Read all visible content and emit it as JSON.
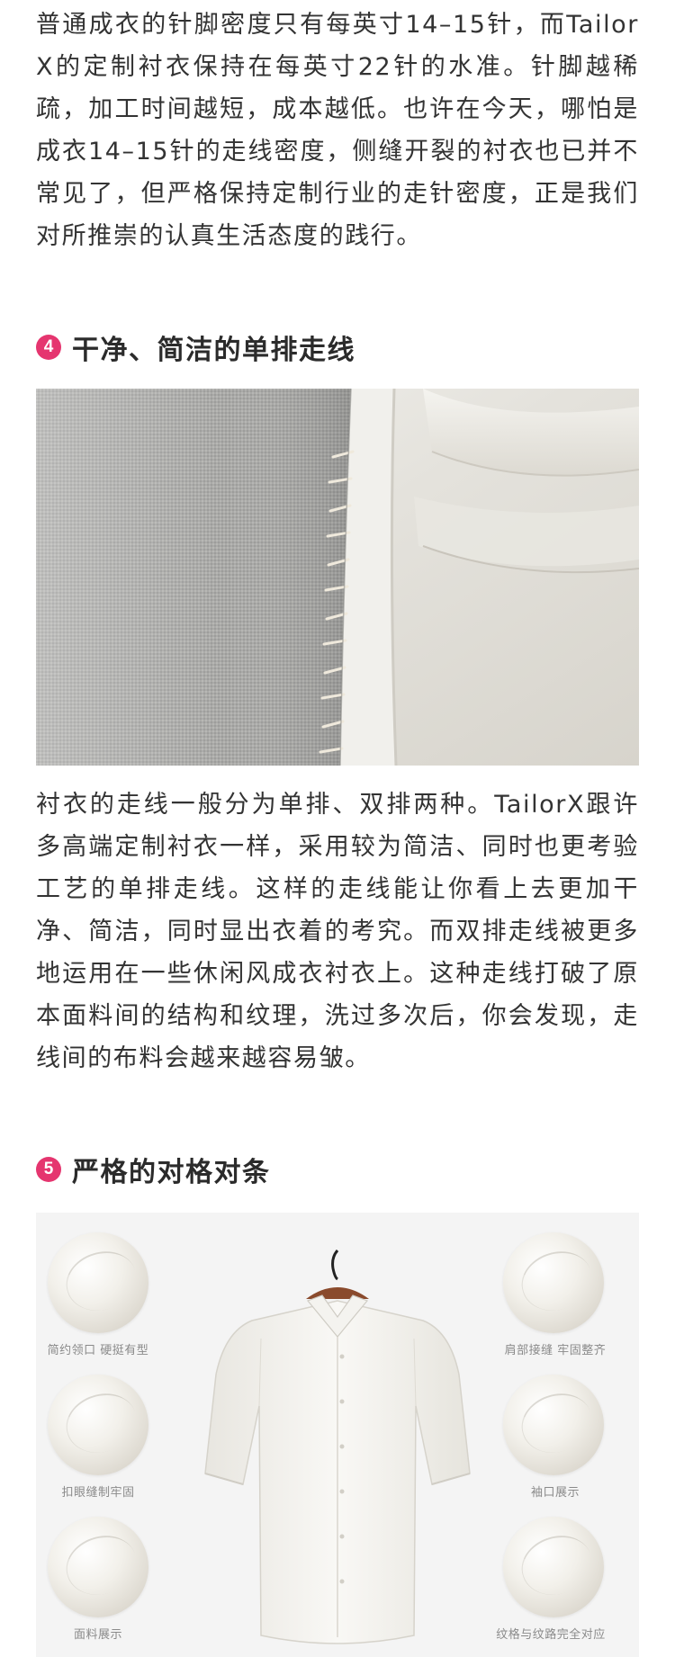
{
  "paragraphs": {
    "p1": "普通成衣的针脚密度只有每英寸14–15针，而TailorX的定制衬衣保持在每英寸22针的水准。针脚越稀疏，加工时间越短，成本越低。也许在今天，哪怕是成衣14–15针的走线密度，侧缝开裂的衬衣也已并不常见了，但严格保持定制行业的走针密度，正是我们对所推崇的认真生活态度的践行。",
    "p2": "衬衣的走线一般分为单排、双排两种。TailorX跟许多高端定制衬衣一样，采用较为简洁、同时也更考验工艺的单排走线。这样的走线能让你看上去更加干净、简洁，同时显出衣着的考究。而双排走线被更多地运用在一些休闲风成衣衬衣上。这种走线打破了原本面料间的结构和纹理，洗过多次后，你会发现，走线间的布料会越来越容易皱。"
  },
  "sections": [
    {
      "number": "4",
      "title": "干净、简洁的单排走线"
    },
    {
      "number": "5",
      "title": "严格的对格对条"
    }
  ],
  "shirt_details": {
    "collar": "简约领口 硬挺有型",
    "buttonhole": "扣眼缝制牢固",
    "fabric": "面料展示",
    "shoulder": "肩部接缝 牢固整齐",
    "cuff": "袖口展示",
    "pattern": "纹格与纹路完全对应"
  },
  "colors": {
    "badge": "#e5356f",
    "text": "#333333",
    "heading": "#2b2b2b"
  }
}
